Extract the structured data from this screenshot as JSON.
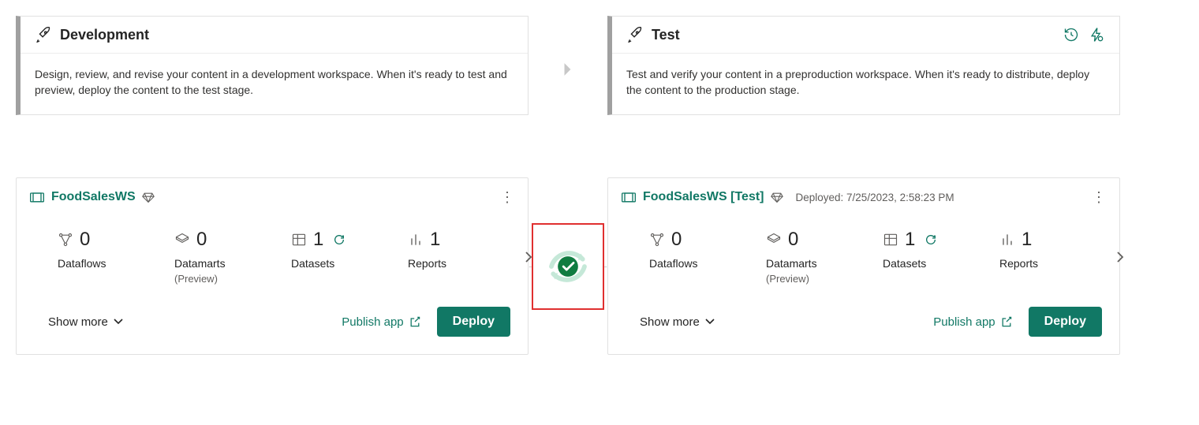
{
  "stages": {
    "dev": {
      "title": "Development",
      "description": "Design, review, and revise your content in a development workspace. When it's ready to test and preview, deploy the content to the test stage."
    },
    "test": {
      "title": "Test",
      "description": "Test and verify your content in a preproduction workspace. When it's ready to distribute, deploy the content to the production stage."
    }
  },
  "workspaces": {
    "dev": {
      "name": "FoodSalesWS",
      "metrics": {
        "dataflows": {
          "value": "0",
          "label": "Dataflows"
        },
        "datamarts": {
          "value": "0",
          "label": "Datamarts",
          "sub": "(Preview)"
        },
        "datasets": {
          "value": "1",
          "label": "Datasets"
        },
        "reports": {
          "value": "1",
          "label": "Reports"
        }
      }
    },
    "test": {
      "name": "FoodSalesWS [Test]",
      "deployed": "Deployed: 7/25/2023, 2:58:23 PM",
      "metrics": {
        "dataflows": {
          "value": "0",
          "label": "Dataflows"
        },
        "datamarts": {
          "value": "0",
          "label": "Datamarts",
          "sub": "(Preview)"
        },
        "datasets": {
          "value": "1",
          "label": "Datasets"
        },
        "reports": {
          "value": "1",
          "label": "Reports"
        }
      }
    }
  },
  "labels": {
    "show_more": "Show more",
    "publish_app": "Publish app",
    "deploy": "Deploy"
  }
}
